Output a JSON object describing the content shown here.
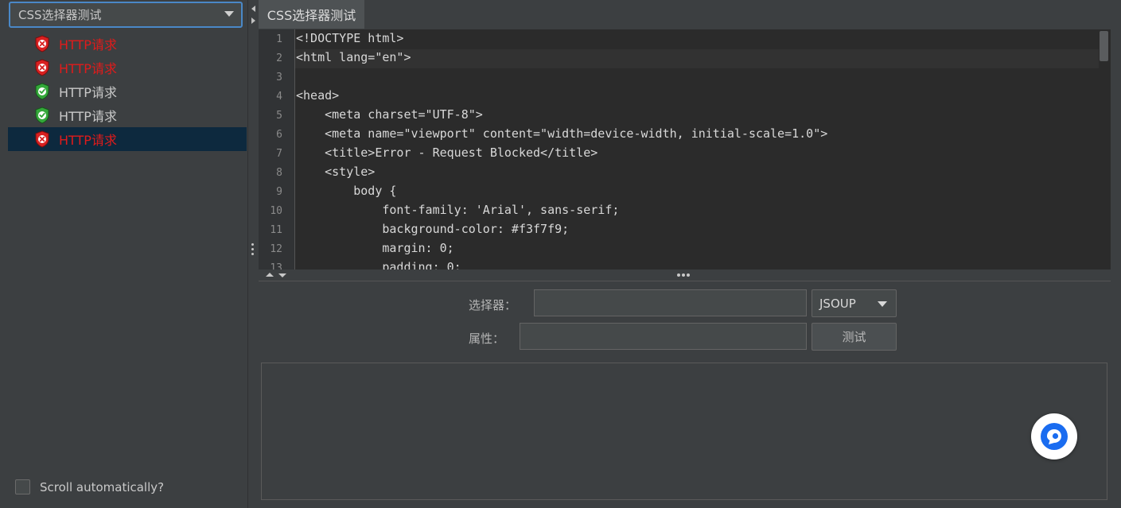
{
  "left_panel": {
    "selector": {
      "value": "CSS选择器测试"
    },
    "results": [
      {
        "label": "HTTP请求",
        "status": "fail"
      },
      {
        "label": "HTTP请求",
        "status": "fail"
      },
      {
        "label": "HTTP请求",
        "status": "success"
      },
      {
        "label": "HTTP请求",
        "status": "success"
      },
      {
        "label": "HTTP请求",
        "status": "fail",
        "selected": true
      }
    ],
    "scroll_checkbox": {
      "label": "Scroll automatically?",
      "checked": false
    }
  },
  "tab": {
    "label": "CSS选择器测试"
  },
  "editor": {
    "line_numbers": [
      "1",
      "2",
      "3",
      "4",
      "5",
      "6",
      "7",
      "8",
      "9",
      "10",
      "11",
      "12",
      "13"
    ],
    "lines": [
      "<!DOCTYPE html>",
      "<html lang=\"en\">",
      "",
      "<head>",
      "    <meta charset=\"UTF-8\">",
      "    <meta name=\"viewport\" content=\"width=device-width, initial-scale=1.0\">",
      "    <title>Error - Request Blocked</title>",
      "    <style>",
      "        body {",
      "            font-family: 'Arial', sans-serif;",
      "            background-color: #f3f7f9;",
      "            margin: 0;",
      "            padding: 0;"
    ]
  },
  "form": {
    "selector_label": "选择器：",
    "selector_value": "",
    "attribute_label": "属性：",
    "attribute_value": "",
    "engine": "JSOUP",
    "test_button": "测试"
  },
  "colors": {
    "fail": "#e01b1b",
    "success": "#3cb043",
    "accent": "#1a73e8"
  }
}
